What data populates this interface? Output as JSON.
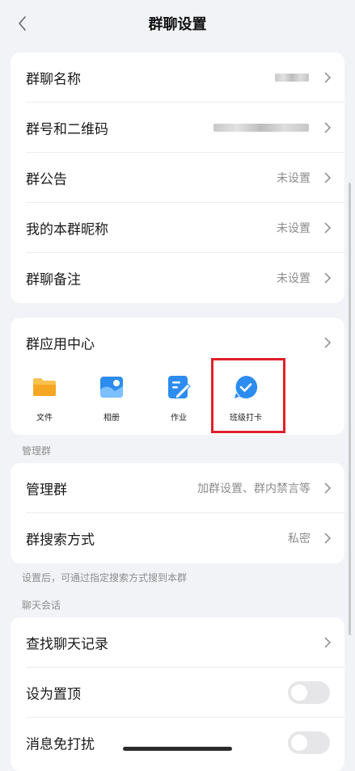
{
  "header": {
    "title": "群聊设置"
  },
  "group_info": [
    {
      "label": "群聊名称",
      "value": ""
    },
    {
      "label": "群号和二维码",
      "value": ""
    },
    {
      "label": "群公告",
      "value": "未设置"
    },
    {
      "label": "我的本群昵称",
      "value": "未设置"
    },
    {
      "label": "群聊备注",
      "value": "未设置"
    }
  ],
  "app_center": {
    "title": "群应用中心",
    "apps": [
      {
        "label": "文件",
        "icon": "folder-icon",
        "color": "#f5b432"
      },
      {
        "label": "相册",
        "icon": "photo-album-icon",
        "color": "#2d8cf0"
      },
      {
        "label": "作业",
        "icon": "homework-icon",
        "color": "#2d8cf0"
      },
      {
        "label": "班级打卡",
        "icon": "check-in-icon",
        "color": "#2d8cf0"
      }
    ]
  },
  "manage": {
    "section_label": "管理群",
    "rows": [
      {
        "label": "管理群",
        "value": "加群设置、群内禁言等"
      },
      {
        "label": "群搜索方式",
        "value": "私密"
      }
    ],
    "hint": "设置后，可通过指定搜索方式搜到本群"
  },
  "chat": {
    "section_label": "聊天会话",
    "rows": [
      {
        "label": "查找聊天记录"
      },
      {
        "label": "设为置顶",
        "toggle_on": false
      },
      {
        "label": "消息免打扰",
        "toggle_on": false
      }
    ]
  },
  "colors": {
    "background": "#f2f3f7",
    "accent": "#2d8cf0",
    "highlight": "#e0202a"
  }
}
